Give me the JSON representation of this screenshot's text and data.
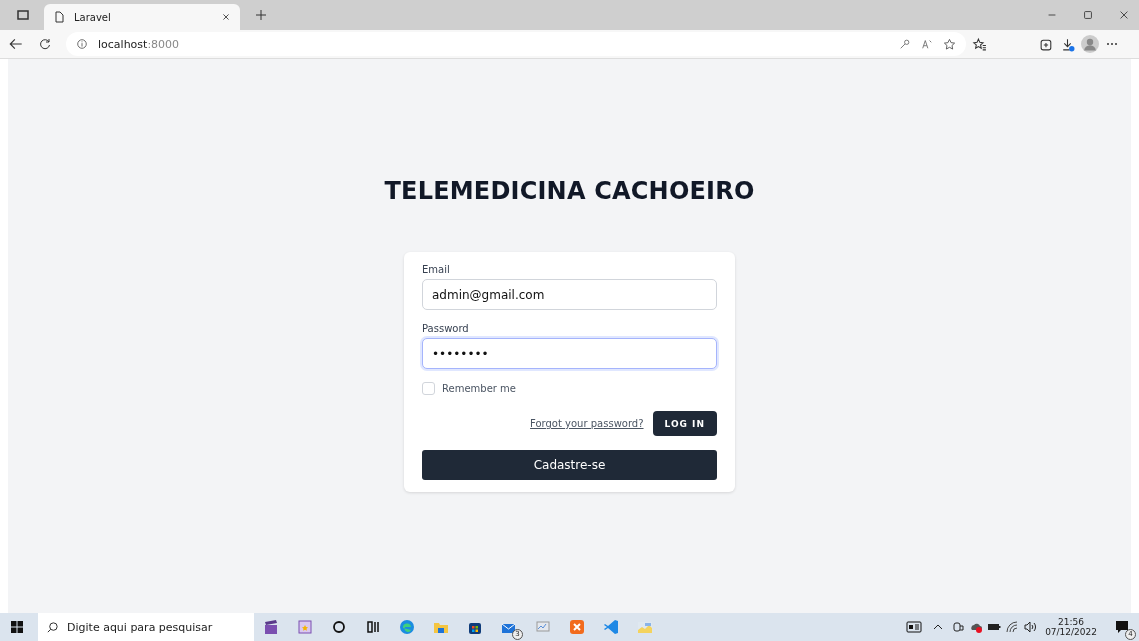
{
  "browser": {
    "tab": {
      "title": "Laravel",
      "selected": true
    },
    "address": {
      "host": "localhost",
      "port": ":8000"
    }
  },
  "page": {
    "heading": "TELEMEDICINA CACHOEIRO",
    "form": {
      "email": {
        "label": "Email",
        "value": "admin@gmail.com"
      },
      "password": {
        "label": "Password",
        "value": "••••••••",
        "focused": true
      },
      "remember": {
        "label": "Remember me",
        "checked": false
      },
      "forgot_link": "Forgot your password?",
      "login_button": "LOG IN",
      "register_button": "Cadastre-se"
    }
  },
  "taskbar": {
    "search_placeholder": "Digite aqui para pesquisar",
    "mail_badge": "3",
    "time": "21:56",
    "date": "07/12/2022",
    "notifications_badge": "4"
  }
}
